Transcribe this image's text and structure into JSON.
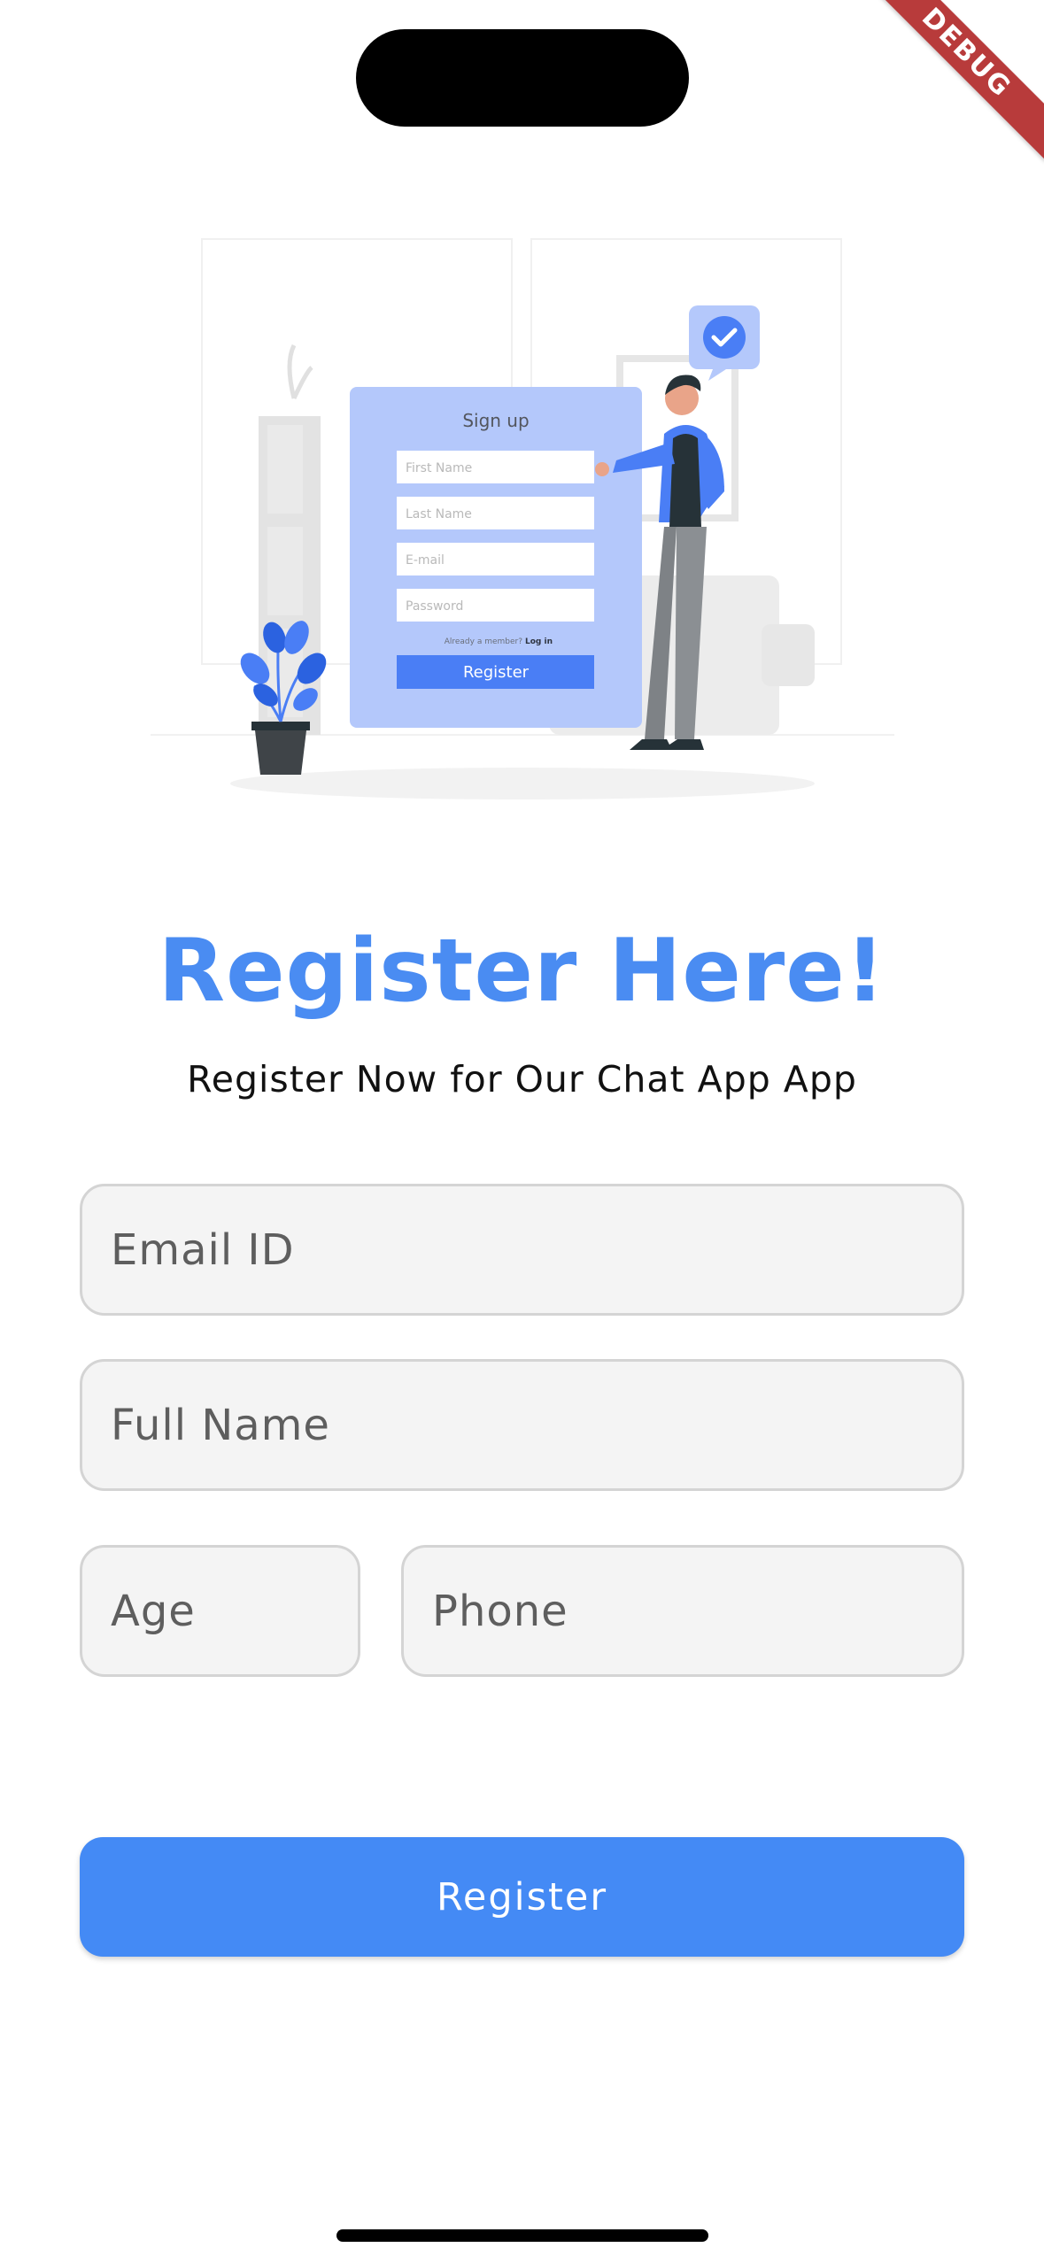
{
  "debug_banner": "DEBUG",
  "illustration": {
    "card_title": "Sign up",
    "fields": [
      "First Name",
      "Last Name",
      "E-mail",
      "Password"
    ],
    "member_text": "Already a member?",
    "login_link": "Log in",
    "button_label": "Register"
  },
  "title": "Register Here!",
  "subtitle": "Register Now for Our Chat App App",
  "form": {
    "email_placeholder": "Email ID",
    "name_placeholder": "Full Name",
    "age_placeholder": "Age",
    "phone_placeholder": "Phone"
  },
  "register_button": "Register",
  "colors": {
    "accent": "#448af5",
    "title": "#4a8cf2"
  }
}
